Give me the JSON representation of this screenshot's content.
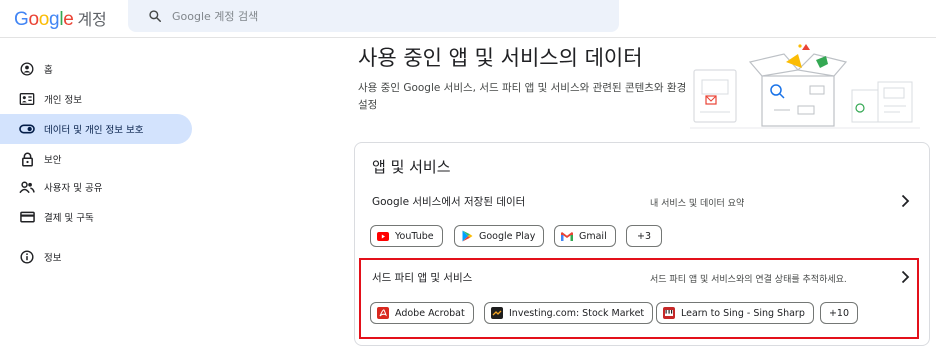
{
  "header": {
    "logo_google": "Google",
    "logo_suffix": "계정",
    "search_placeholder": "Google 계정 검색"
  },
  "sidebar": {
    "items": [
      {
        "label": "홈",
        "icon": "home-icon",
        "active": false
      },
      {
        "label": "개인 정보",
        "icon": "id-card-icon",
        "active": false
      },
      {
        "label": "데이터 및 개인 정보 보호",
        "icon": "toggle-icon",
        "active": true
      },
      {
        "label": "보안",
        "icon": "lock-icon",
        "active": false
      },
      {
        "label": "사용자 및 공유",
        "icon": "people-icon",
        "active": false
      },
      {
        "label": "결제 및 구독",
        "icon": "credit-card-icon",
        "active": false
      },
      {
        "label": "정보",
        "icon": "info-icon",
        "active": false
      }
    ]
  },
  "main": {
    "title": "사용 중인 앱 및 서비스의 데이터",
    "description": "사용 중인 Google 서비스, 서드 파티 앱 및 서비스와 관련된 콘텐츠와 환경설정",
    "card": {
      "title": "앱 및 서비스",
      "google_services": {
        "title": "Google 서비스에서 저장된 데이터",
        "subtitle": "내 서비스 및 데이터 요약",
        "chips": [
          "YouTube",
          "Google Play",
          "Gmail"
        ],
        "more": "+3"
      },
      "third_party": {
        "title": "서드 파티 앱 및 서비스",
        "subtitle": "서드 파티 앱 및 서비스와의 연결 상태를 추적하세요.",
        "chips": [
          "Adobe Acrobat",
          "Investing.com: Stock Market",
          "Learn to Sing - Sing Sharp"
        ],
        "more": "+10"
      }
    }
  },
  "colors": {
    "active_nav": "#d3e3fd",
    "highlight_border": "#e3101a",
    "search_bg": "#edf2fa"
  }
}
